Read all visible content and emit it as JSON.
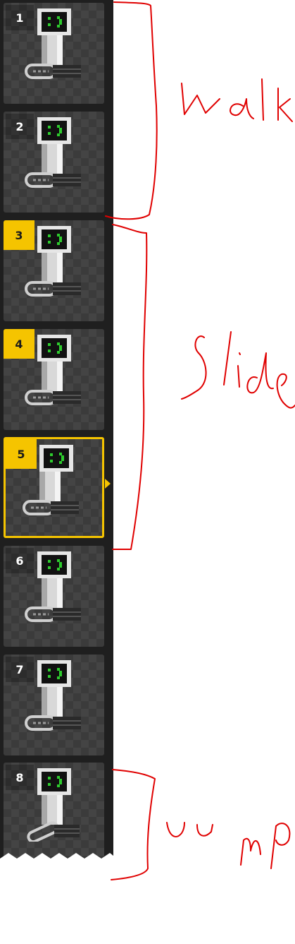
{
  "frames": [
    {
      "number": "1",
      "pose": "walk-a"
    },
    {
      "number": "2",
      "pose": "walk-b"
    },
    {
      "number": "3",
      "pose": "walk-a",
      "marked": true
    },
    {
      "number": "4",
      "pose": "walk-b",
      "marked": true
    },
    {
      "number": "5",
      "pose": "slide",
      "marked": true,
      "selected": true
    },
    {
      "number": "6",
      "pose": "walk-b"
    },
    {
      "number": "7",
      "pose": "walk-a"
    },
    {
      "number": "8",
      "pose": "jump"
    }
  ],
  "annotations": {
    "walk": "Walk",
    "slide": "Slide",
    "jump": "Jump"
  },
  "colors": {
    "accent": "#f5c400",
    "annotation": "#e00000",
    "strip_bg": "#1f1f1f",
    "screen_face": "#2ecc2e"
  }
}
